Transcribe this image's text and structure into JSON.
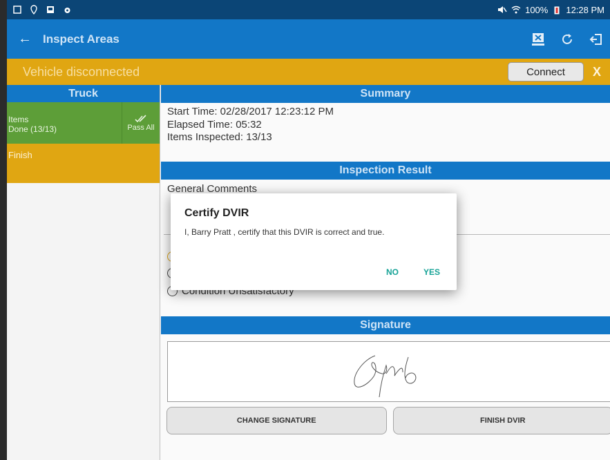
{
  "status_bar": {
    "battery": "100%",
    "time": "12:28 PM",
    "icons": [
      "screenshot-icon",
      "location-icon",
      "gallery-icon",
      "bug-icon",
      "mute-icon",
      "wifi-icon",
      "battery-icon"
    ]
  },
  "app_bar": {
    "title": "Inspect Areas",
    "back_icon": "arrow-left-icon",
    "actions": [
      "delete-dvir-icon",
      "refresh-icon",
      "logout-icon"
    ]
  },
  "connection_bar": {
    "message": "Vehicle disconnected",
    "connect_label": "Connect",
    "close_label": "X"
  },
  "left_panel": {
    "header": "Truck",
    "items": {
      "label": "Items",
      "progress": "Done (13/13)",
      "pass_all_label": "Pass All"
    },
    "finish_label": "Finish"
  },
  "summary": {
    "header": "Summary",
    "start_time": "Start Time: 02/28/2017 12:23:12 PM",
    "elapsed_time": "Elapsed Time: 05:32",
    "items_inspected": "Items Inspected: 13/13"
  },
  "inspection_result": {
    "header": "Inspection Result",
    "general_comments_label": "General Comments",
    "options": [
      "Condition Unsatisfactory"
    ]
  },
  "signature": {
    "header": "Signature",
    "change_label": "CHANGE SIGNATURE",
    "finish_label": "FINISH DVIR"
  },
  "dialog": {
    "title": "Certify DVIR",
    "message": "I, Barry Pratt , certify that this DVIR is correct and true.",
    "no_label": "NO",
    "yes_label": "YES"
  },
  "colors": {
    "primary": "#1277c7",
    "status_bar": "#0b4576",
    "warning": "#e0a612",
    "success": "#5d9e38",
    "dialog_accent": "#17a397"
  }
}
